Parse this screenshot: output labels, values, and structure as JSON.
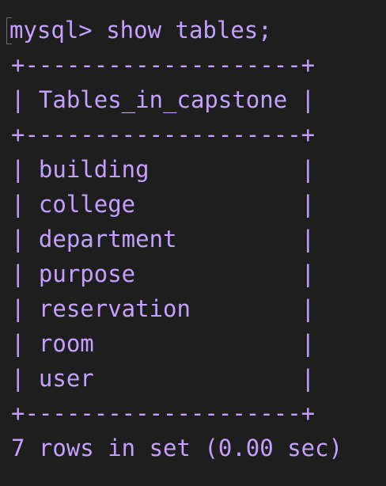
{
  "terminal": {
    "prompt": "mysql> show tables;",
    "border_top": "+--------------------+",
    "header_row": "| Tables_in_capstone |",
    "border_mid": "+--------------------+",
    "rows": [
      "| building           |",
      "| college            |",
      "| department         |",
      "| purpose            |",
      "| reservation        |",
      "| room               |",
      "| user               |"
    ],
    "border_bottom": "+--------------------+",
    "summary": "7 rows in set (0.00 sec)"
  },
  "colors": {
    "background": "#1e1e1e",
    "text": "#c3a0ff"
  }
}
